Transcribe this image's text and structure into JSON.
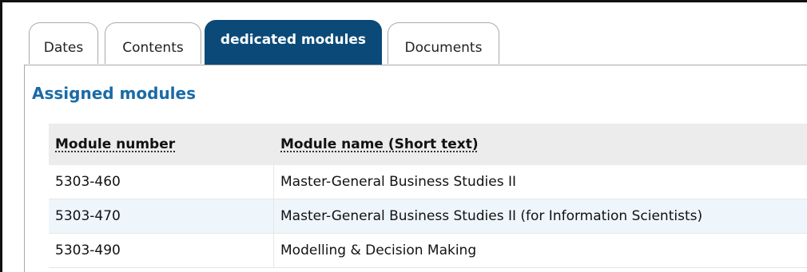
{
  "tabs": [
    {
      "label": "Dates",
      "active": false
    },
    {
      "label": "Contents",
      "active": false
    },
    {
      "label": "dedicated modules",
      "active": true
    },
    {
      "label": "Documents",
      "active": false
    }
  ],
  "section": {
    "title": "Assigned modules"
  },
  "table": {
    "headers": [
      "Module number",
      "Module name (Short text)"
    ],
    "rows": [
      [
        "5303-460",
        "Master-General Business Studies II"
      ],
      [
        "5303-470",
        "Master-General Business Studies II (for Information Scientists)"
      ],
      [
        "5303-490",
        "Modelling & Decision Making"
      ]
    ]
  },
  "colors": {
    "active_tab": "#0b4a78",
    "section_title": "#1a6aa6",
    "header_bg": "#ececec",
    "alt_row": "#eef6fc"
  }
}
